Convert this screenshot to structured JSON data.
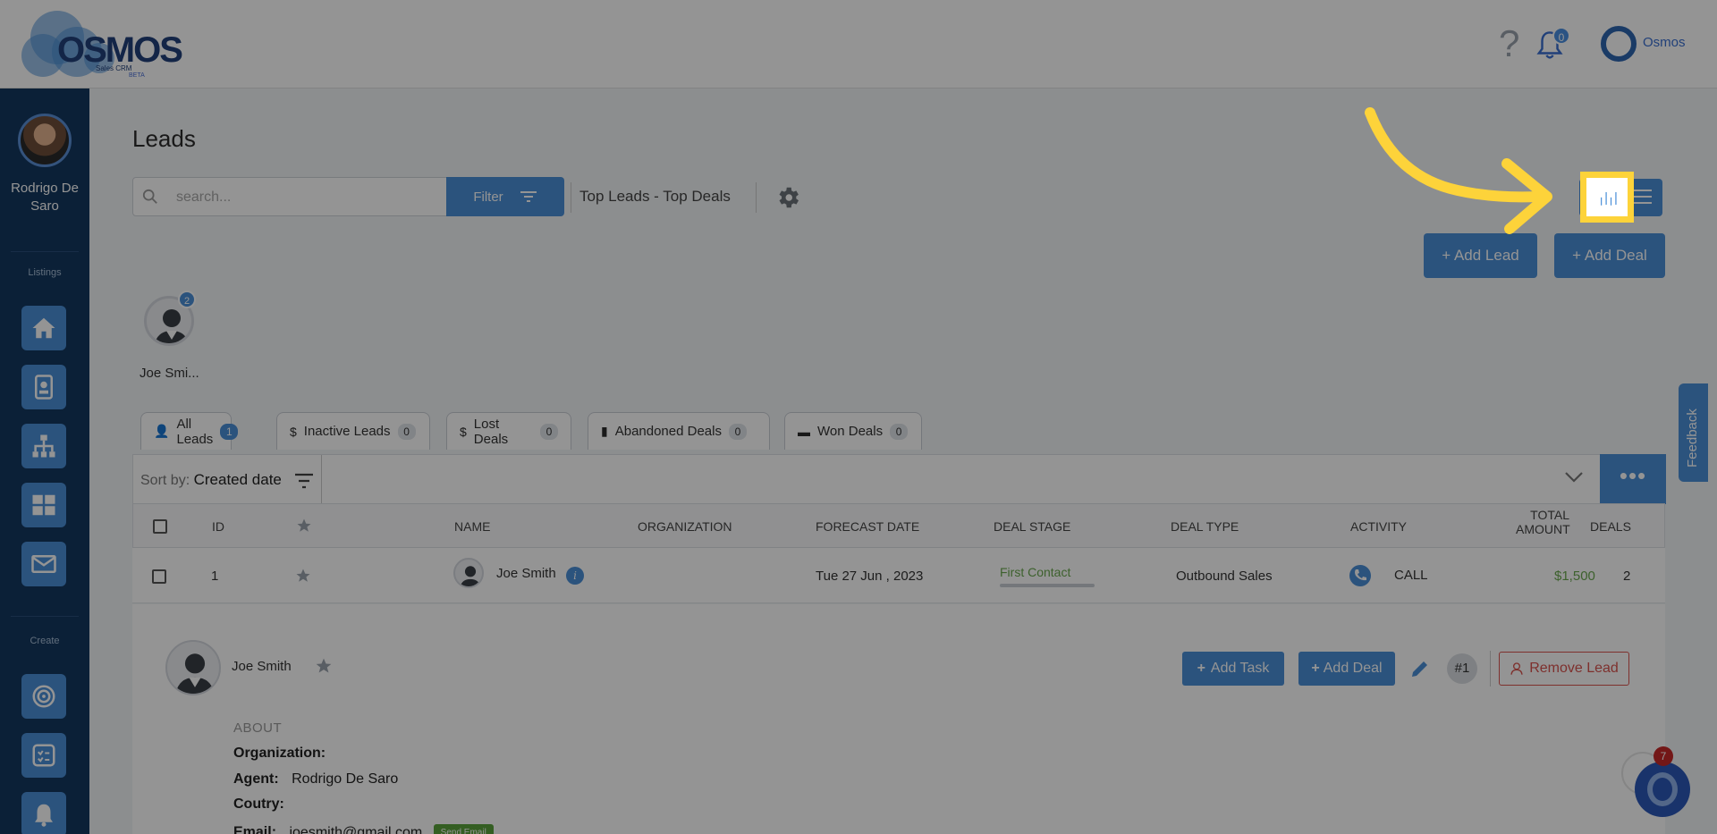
{
  "brand": {
    "logo_text": "OSMOS",
    "logo_sub": "Sales CRM",
    "logo_beta": "BETA"
  },
  "header": {
    "help_glyph": "?",
    "notifications_count": "0",
    "user_name": "Osmos"
  },
  "sidebar": {
    "user_name": "Rodrigo De Saro",
    "sections": {
      "listings": "Listings",
      "create": "Create"
    },
    "listing_items": [
      {
        "icon": "home-icon"
      },
      {
        "icon": "contact-card-icon"
      },
      {
        "icon": "org-chart-icon"
      },
      {
        "icon": "grid-icon"
      },
      {
        "icon": "mail-icon"
      }
    ],
    "create_items": [
      {
        "icon": "target-icon"
      },
      {
        "icon": "checklist-icon"
      },
      {
        "icon": "bell-icon"
      }
    ]
  },
  "page": {
    "title": "Leads"
  },
  "toolbar": {
    "search_placeholder": "search...",
    "filter_label": "Filter",
    "view_name": "Top Leads - Top Deals",
    "kanban_glyph": "╷|╷|",
    "add_lead_label": "+ Add Lead",
    "add_deal_label": "+ Add Deal"
  },
  "agent": {
    "name": "Joe Smi...",
    "badge": "2"
  },
  "tabs": [
    {
      "label": "All Leads",
      "count": "1",
      "icon": "person-icon",
      "glyph": "👤"
    },
    {
      "label": "Inactive Leads",
      "count": "0",
      "icon": "dollar-icon",
      "glyph": "$"
    },
    {
      "label": "Lost Deals",
      "count": "0",
      "icon": "dollar-icon",
      "glyph": "$"
    },
    {
      "label": "Abandoned Deals",
      "count": "0",
      "icon": "file-icon",
      "glyph": "▮"
    },
    {
      "label": "Won Deals",
      "count": "0",
      "icon": "card-icon",
      "glyph": "▬"
    }
  ],
  "sort": {
    "prefix": "Sort by:",
    "value": "Created date",
    "more_glyph": "•••"
  },
  "table": {
    "columns": {
      "id": "ID",
      "name": "NAME",
      "organization": "ORGANIZATION",
      "forecast": "FORECAST DATE",
      "stage": "DEAL STAGE",
      "type": "DEAL TYPE",
      "activity": "ACTIVITY",
      "total_amount_1": "TOTAL",
      "total_amount_2": "AMOUNT",
      "deals": "DEALS"
    },
    "rows": [
      {
        "id": "1",
        "name": "Joe Smith",
        "info": "i",
        "forecast": "Tue 27 Jun , 2023",
        "stage": "First Contact",
        "type": "Outbound Sales",
        "activity": "CALL",
        "amount": "$1,500",
        "deals": "2"
      }
    ]
  },
  "detail": {
    "name": "Joe Smith",
    "add_task_label": "Add Task",
    "add_deal_label": "Add Deal",
    "number_badge": "#1",
    "remove_label": "Remove Lead",
    "about_heading": "ABOUT",
    "organization_key": "Organization:",
    "organization_value": "",
    "agent_key": "Agent:",
    "agent_value": "Rodrigo De Saro",
    "country_key": "Coutry:",
    "country_value": "",
    "email_key": "Email:",
    "email_value": "joesmith@gmail.com",
    "send_email_label": "Send Email"
  },
  "feedback": {
    "label": "Feedback"
  },
  "chat": {
    "badge": "7"
  },
  "colors": {
    "accent": "#4a8fd8",
    "sidebar": "#13375f",
    "highlight": "#fdd33a",
    "amount": "#6aa84f",
    "danger": "#d9534f"
  }
}
